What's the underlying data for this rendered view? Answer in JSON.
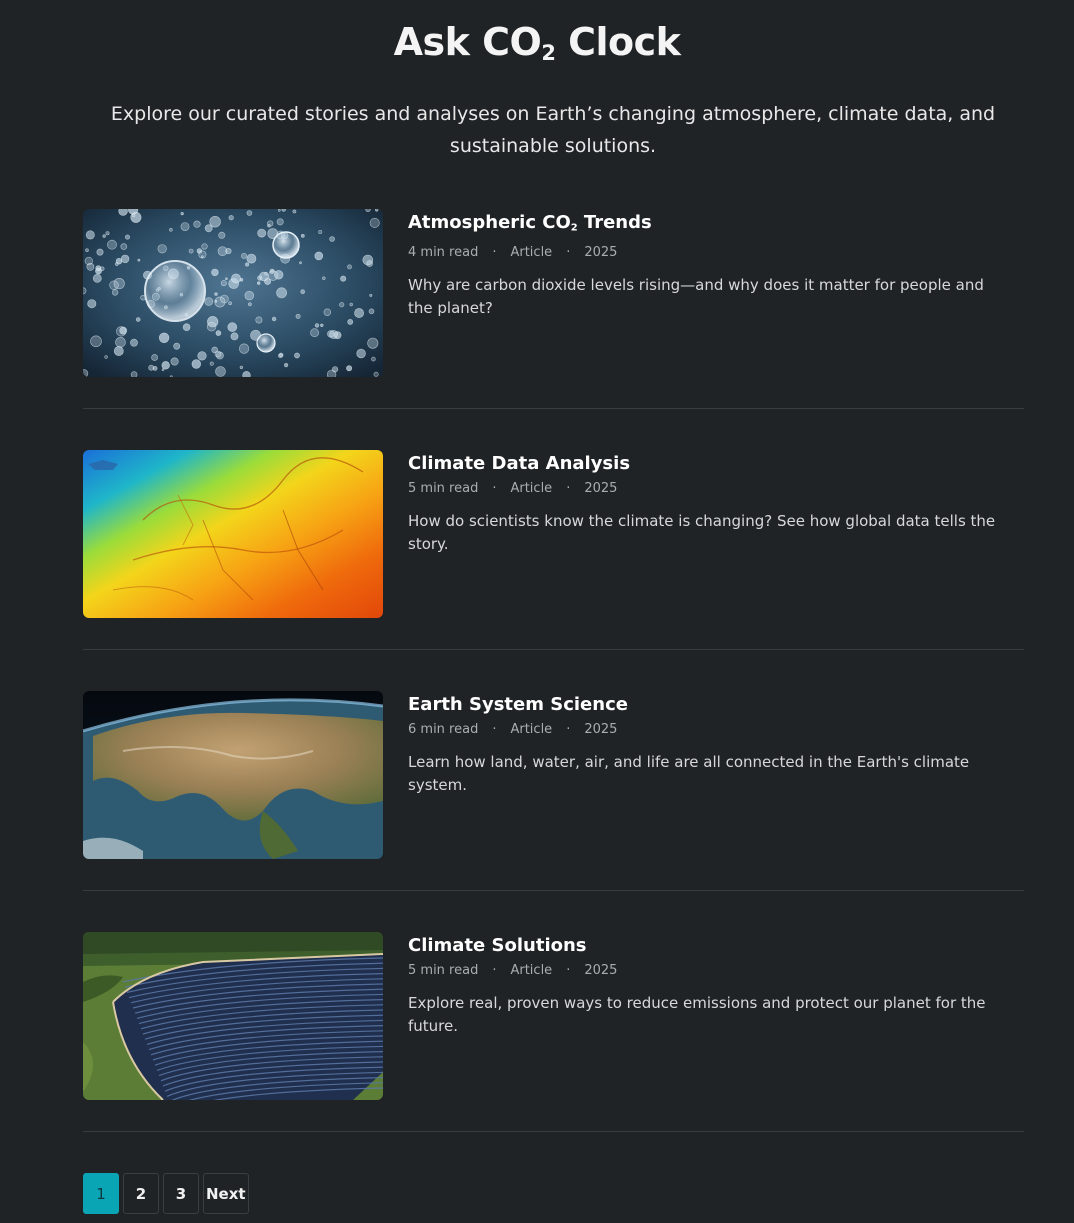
{
  "header": {
    "title_pre": "Ask CO",
    "title_sub": "2",
    "title_post": " Clock",
    "subtitle": "Explore our curated stories and analyses on Earth’s changing atmosphere, climate data, and sustainable solutions."
  },
  "articles": [
    {
      "title_pre": "Atmospheric CO",
      "title_sub": "2",
      "title_post": " Trends",
      "read_time": "4 min read",
      "type": "Article",
      "year": "2025",
      "description": "Why are carbon dioxide levels rising—and why does it matter for people and the planet?",
      "image_icon": "bubbles-image"
    },
    {
      "title_pre": "Climate Data Analysis",
      "title_sub": "",
      "title_post": "",
      "read_time": "5 min read",
      "type": "Article",
      "year": "2025",
      "description": "How do scientists know the climate is changing? See how global data tells the story.",
      "image_icon": "heatmap-image"
    },
    {
      "title_pre": "Earth System Science",
      "title_sub": "",
      "title_post": "",
      "read_time": "6 min read",
      "type": "Article",
      "year": "2025",
      "description": "Learn how land, water, air, and life are all connected in the Earth's climate system.",
      "image_icon": "earth-image"
    },
    {
      "title_pre": "Climate Solutions",
      "title_sub": "",
      "title_post": "",
      "read_time": "5 min read",
      "type": "Article",
      "year": "2025",
      "description": "Explore real, proven ways to reduce emissions and protect our planet for the future.",
      "image_icon": "solar-farm-image"
    }
  ],
  "meta_separator": "·",
  "pagination": {
    "pages": [
      "1",
      "2",
      "3"
    ],
    "active": "1",
    "next_label": "Next"
  },
  "colors": {
    "background": "#202326",
    "accent": "#0aa5b5"
  }
}
